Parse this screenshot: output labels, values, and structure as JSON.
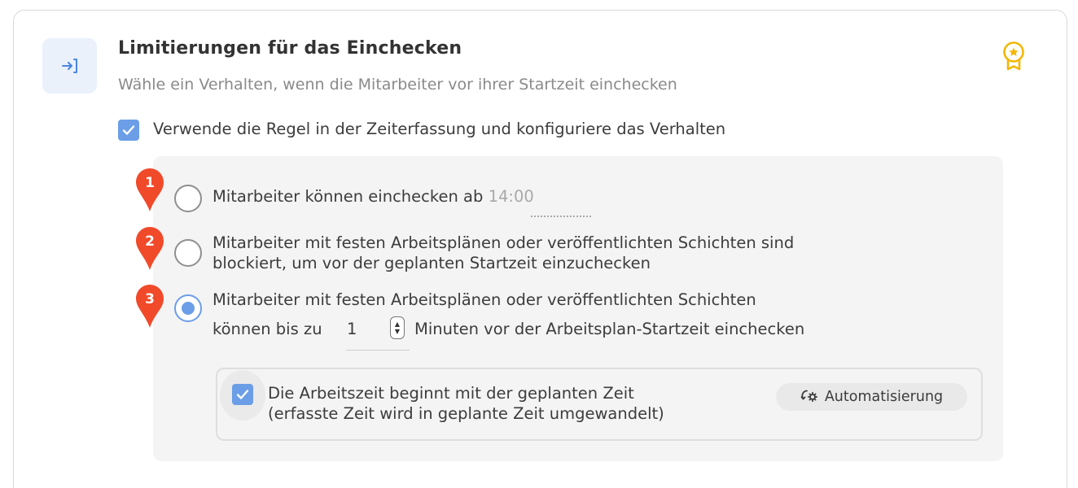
{
  "header": {
    "title": "Limitierungen für das Einchecken",
    "subtitle": "Wähle ein Verhalten, wenn die Mitarbeiter vor ihrer Startzeit einchecken"
  },
  "rule": {
    "checked": true,
    "label": "Verwende die Regel in der Zeiterfassung und konfiguriere das Verhalten"
  },
  "options": [
    {
      "marker": "1",
      "selected": false,
      "label": "Mitarbeiter können einchecken ab",
      "time_value": "14:00"
    },
    {
      "marker": "2",
      "selected": false,
      "line1": "Mitarbeiter mit festen Arbeitsplänen oder veröffentlichten Schichten sind",
      "line2": "blockiert, um vor der geplanten Startzeit einzuchecken"
    },
    {
      "marker": "3",
      "selected": true,
      "line1": "Mitarbeiter mit festen Arbeitsplänen oder veröffentlichten Schichten",
      "before_input": "können bis zu",
      "minutes_value": "1",
      "after_input": "Minuten vor der Arbeitsplan-Startzeit einchecken"
    }
  ],
  "sub_option": {
    "checked": true,
    "line1": "Die Arbeitszeit beginnt mit der geplanten Zeit",
    "line2": "(erfasste Zeit wird in geplante Zeit umgewandelt)",
    "button_label": "Automatisierung"
  },
  "colors": {
    "accent": "#6b9ee6",
    "marker": "#f04a2a",
    "badge": "#f2b705"
  },
  "icons": {
    "header": "login-icon",
    "badge": "award-icon",
    "automation": "automation-gear-icon"
  }
}
